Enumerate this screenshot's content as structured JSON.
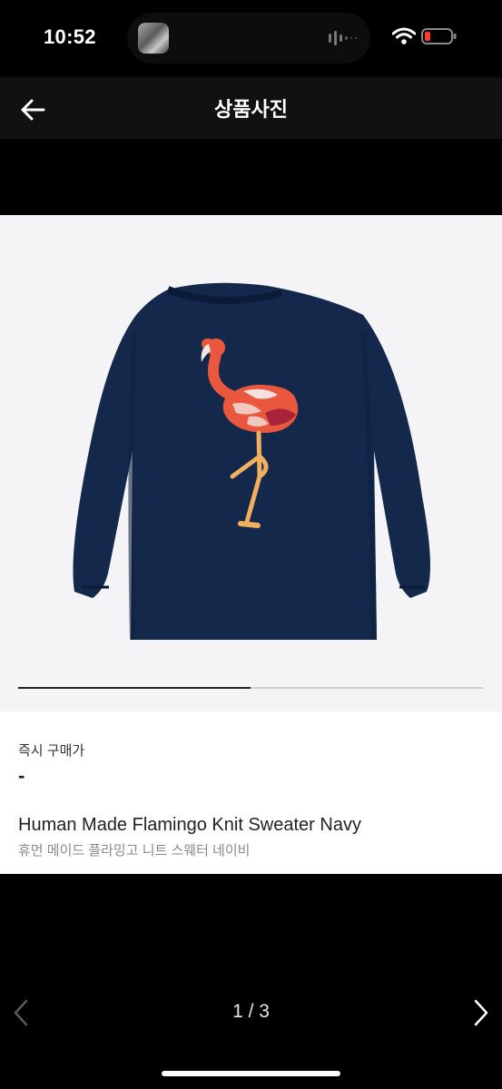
{
  "status_bar": {
    "time": "10:52"
  },
  "nav": {
    "title": "상품사진",
    "back_icon": "arrow-left-icon"
  },
  "gallery": {
    "current_index": 1,
    "total": 3,
    "pager_text": "1 / 3",
    "progress_fraction": 0.5
  },
  "product": {
    "price_label": "즉시 구매가",
    "price_value": "-",
    "name": "Human Made Flamingo Knit Sweater Navy",
    "name_ko": "휴먼 메이드 플라밍고 니트 스웨터 네이비"
  },
  "colors": {
    "sweater_navy": "#13284a",
    "flamingo_pink": "#e8573e",
    "leg_orange": "#f0b060",
    "photo_bg": "#f4f4f6"
  }
}
